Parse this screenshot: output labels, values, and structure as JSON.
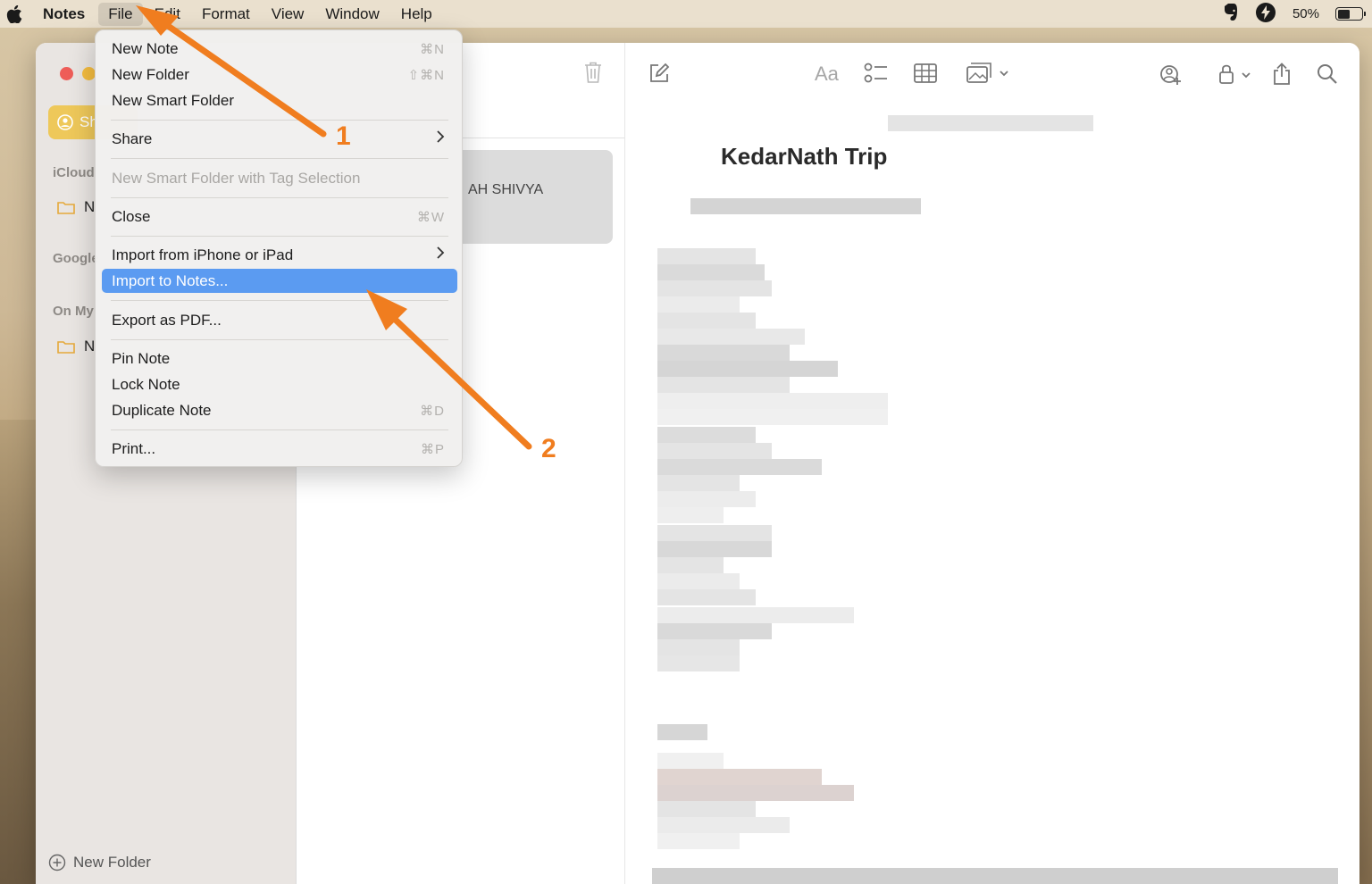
{
  "menubar": {
    "app_name": "Notes",
    "items": [
      "File",
      "Edit",
      "Format",
      "View",
      "Window",
      "Help"
    ],
    "battery_percent": "50%",
    "battery_level": 0.5
  },
  "sidebar": {
    "shared_label": "Sh",
    "sections": [
      "iCloud",
      "Google",
      "On My"
    ],
    "folder_label": "N",
    "new_folder": "New Folder"
  },
  "notelist": {
    "selected_note_title": "AH SHIVYA"
  },
  "editor": {
    "note_title": "KedarNath Trip",
    "format_label": "Aa"
  },
  "file_menu": {
    "items": [
      {
        "label": "New Note",
        "shortcut": "⌘N"
      },
      {
        "label": "New Folder",
        "shortcut": "⇧⌘N"
      },
      {
        "label": "New Smart Folder",
        "shortcut": ""
      },
      {
        "label": "Share",
        "shortcut": ""
      },
      {
        "label": "New Smart Folder with Tag Selection",
        "shortcut": ""
      },
      {
        "label": "Close",
        "shortcut": "⌘W"
      },
      {
        "label": "Import from iPhone or iPad",
        "shortcut": ""
      },
      {
        "label": "Import to Notes...",
        "shortcut": ""
      },
      {
        "label": "Export as PDF...",
        "shortcut": ""
      },
      {
        "label": "Pin Note",
        "shortcut": ""
      },
      {
        "label": "Lock Note",
        "shortcut": ""
      },
      {
        "label": "Duplicate Note",
        "shortcut": "⌘D"
      },
      {
        "label": "Print...",
        "shortcut": "⌘P"
      }
    ]
  },
  "annotations": {
    "step1": "1",
    "step2": "2",
    "color": "#f07d1f"
  },
  "colors": {
    "menu_highlight": "#5b9bf1",
    "accent_yellow": "#eec85a"
  }
}
